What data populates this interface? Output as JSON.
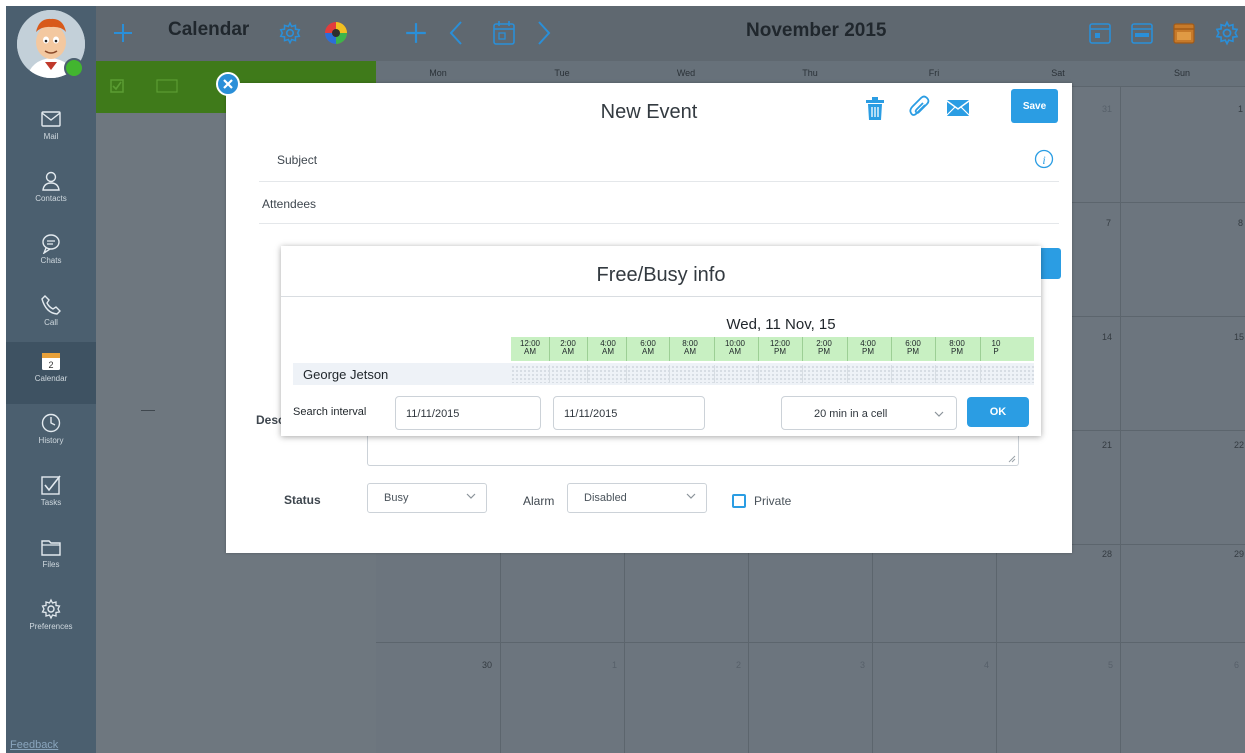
{
  "nav": {
    "items": [
      {
        "label": "Mail",
        "icon": "mail-icon"
      },
      {
        "label": "Contacts",
        "icon": "contacts-icon"
      },
      {
        "label": "Chats",
        "icon": "chat-icon"
      },
      {
        "label": "Call",
        "icon": "phone-icon"
      },
      {
        "label": "Calendar",
        "icon": "calendar-icon",
        "badge": "2",
        "active": true
      },
      {
        "label": "History",
        "icon": "clock-icon"
      },
      {
        "label": "Tasks",
        "icon": "tasks-icon"
      },
      {
        "label": "Files",
        "icon": "folder-icon"
      },
      {
        "label": "Preferences",
        "icon": "gear-icon"
      }
    ],
    "feedback": "Feedback"
  },
  "calendar_panel": {
    "title": "Calendar",
    "dash": "—"
  },
  "calendar": {
    "month_title": "November 2015",
    "weekdays": [
      "Mon",
      "Tue",
      "Wed",
      "Thu",
      "Fri",
      "Sat",
      "Sun"
    ],
    "visible_days": {
      "row1": [
        "31",
        "1"
      ],
      "row2": [
        "7",
        "8"
      ],
      "row3": [
        "14",
        "15"
      ],
      "row4": [
        "21",
        "22"
      ],
      "row5": [
        "28",
        "29"
      ],
      "row6": [
        "30",
        "1",
        "2",
        "3",
        "4",
        "5",
        "6"
      ]
    }
  },
  "event_dialog": {
    "title": "New Event",
    "save_label": "Save",
    "subject_label": "Subject",
    "attendees_label": "Attendees",
    "description_label": "Desc",
    "status_label": "Status",
    "status_value": "Busy",
    "alarm_label": "Alarm",
    "alarm_value": "Disabled",
    "private_label": "Private"
  },
  "freebusy": {
    "title": "Free/Busy info",
    "date_heading": "Wed, 11 Nov, 15",
    "hours": [
      {
        "t": "12:00",
        "p": "AM"
      },
      {
        "t": "2:00",
        "p": "AM"
      },
      {
        "t": "4:00",
        "p": "AM"
      },
      {
        "t": "6:00",
        "p": "AM"
      },
      {
        "t": "8:00",
        "p": "AM"
      },
      {
        "t": "10:00",
        "p": "AM"
      },
      {
        "t": "12:00",
        "p": "PM"
      },
      {
        "t": "2:00",
        "p": "PM"
      },
      {
        "t": "4:00",
        "p": "PM"
      },
      {
        "t": "6:00",
        "p": "PM"
      },
      {
        "t": "8:00",
        "p": "PM"
      },
      {
        "t": "10",
        "p": "P"
      }
    ],
    "attendee": "George Jetson",
    "search_label": "Search interval",
    "start_date": "11/11/2015",
    "end_date": "11/11/2015",
    "cell_size": "20 min in a cell",
    "ok_label": "OK"
  },
  "colors": {
    "accent": "#2b9de3",
    "calendar_green": "#3f7a1a",
    "busy_grid": "#c8f0c2",
    "nav_bg": "#4b5f6f"
  }
}
